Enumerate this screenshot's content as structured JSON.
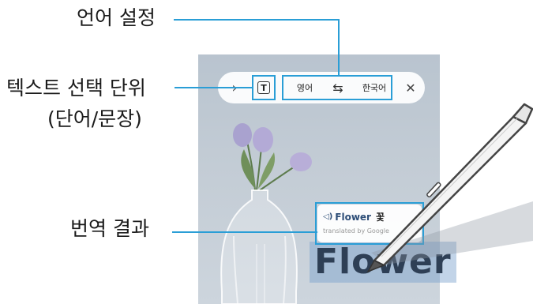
{
  "callouts": {
    "language_settings": "언어 설정",
    "text_unit_line1": "텍스트 선택 단위",
    "text_unit_line2": "(단어/문장)",
    "translation_result": "번역 결과"
  },
  "toolbar": {
    "expand_glyph": "›",
    "text_unit_glyph": "T",
    "source_language": "영어",
    "swap_glyph": "⇆",
    "target_language": "한국어",
    "close_glyph": "✕"
  },
  "translation_popup": {
    "speaker_glyph": "◁)",
    "source_word": "Flower",
    "translated_word": "꽃",
    "attribution": "translated by Google"
  },
  "image_text": "Flower",
  "colors": {
    "callout_line": "#2a9ed6",
    "highlight_box": "#2a9ed6",
    "selected_text_bg": "#7aa0cd"
  },
  "icons": [
    "chevron-right-icon",
    "text-unit-icon",
    "swap-icon",
    "close-icon",
    "speaker-icon",
    "s-pen-icon"
  ]
}
